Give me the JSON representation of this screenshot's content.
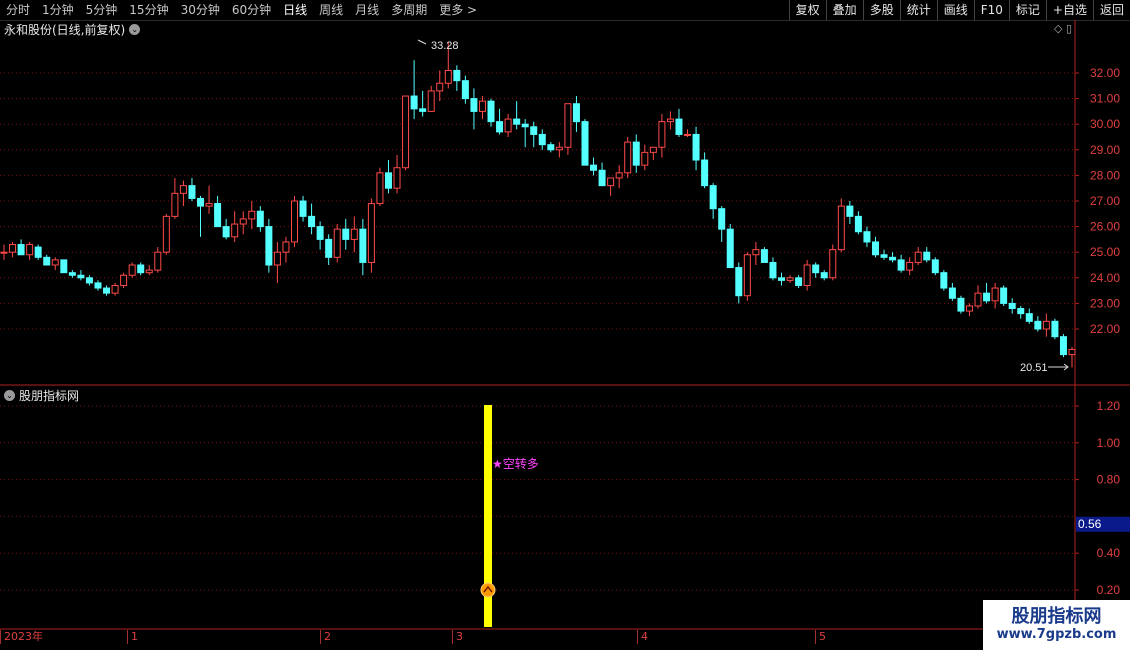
{
  "toolbar": {
    "tabs": [
      "分时",
      "1分钟",
      "5分钟",
      "15分钟",
      "30分钟",
      "60分钟",
      "日线",
      "周线",
      "月线",
      "多周期",
      "更多 >"
    ],
    "active_tab": "日线",
    "tools": [
      "复权",
      "叠加",
      "多股",
      "统计",
      "画线",
      "F10",
      "标记",
      "+自选",
      "返回"
    ]
  },
  "stock": {
    "title": "永和股份(日线,前复权)",
    "high_label": "33.28",
    "low_label": "20.51"
  },
  "indicator": {
    "title": "股朋指标网",
    "signal_label": "★空转多",
    "current_value": "0.56"
  },
  "price_axis": [
    "32.00",
    "31.00",
    "30.00",
    "29.00",
    "28.00",
    "27.00",
    "26.00",
    "25.00",
    "24.00",
    "23.00",
    "22.00"
  ],
  "indicator_axis": [
    "1.20",
    "1.00",
    "0.80",
    "0.40",
    "0.20"
  ],
  "date_axis": [
    "2023年",
    "1",
    "2",
    "3",
    "4",
    "5"
  ],
  "watermark": {
    "line1": "股朋指标网",
    "line2": "www.7gpzb.com"
  },
  "colors": {
    "up": "#ff4a4a",
    "down": "#54ffff",
    "signal": "#ffff00",
    "label": "#ff44ff",
    "grid": "#7a1010"
  },
  "candles": [
    [
      25.0,
      25.3,
      24.7,
      25.0
    ],
    [
      25.0,
      25.4,
      24.8,
      25.3
    ],
    [
      25.3,
      25.5,
      24.9,
      24.9
    ],
    [
      24.9,
      25.4,
      24.7,
      25.3
    ],
    [
      25.2,
      25.3,
      24.7,
      24.8
    ],
    [
      24.8,
      24.9,
      24.5,
      24.5
    ],
    [
      24.5,
      24.8,
      24.3,
      24.7
    ],
    [
      24.7,
      24.7,
      24.2,
      24.2
    ],
    [
      24.2,
      24.3,
      24.0,
      24.1
    ],
    [
      24.1,
      24.3,
      23.9,
      24.0
    ],
    [
      24.0,
      24.1,
      23.7,
      23.8
    ],
    [
      23.8,
      23.9,
      23.5,
      23.6
    ],
    [
      23.6,
      23.7,
      23.3,
      23.4
    ],
    [
      23.4,
      23.8,
      23.3,
      23.7
    ],
    [
      23.7,
      24.2,
      23.6,
      24.1
    ],
    [
      24.1,
      24.6,
      24.0,
      24.5
    ],
    [
      24.5,
      24.6,
      24.1,
      24.2
    ],
    [
      24.2,
      24.5,
      24.1,
      24.3
    ],
    [
      24.3,
      25.2,
      24.2,
      25.0
    ],
    [
      25.0,
      26.5,
      24.9,
      26.4
    ],
    [
      26.4,
      27.9,
      26.3,
      27.3
    ],
    [
      27.3,
      27.8,
      26.8,
      27.6
    ],
    [
      27.6,
      27.9,
      27.0,
      27.1
    ],
    [
      27.1,
      27.2,
      25.6,
      26.8
    ],
    [
      26.8,
      27.6,
      26.5,
      26.9
    ],
    [
      26.9,
      27.2,
      26.0,
      26.0
    ],
    [
      26.0,
      26.3,
      25.5,
      25.6
    ],
    [
      25.6,
      26.6,
      25.4,
      26.1
    ],
    [
      26.1,
      26.6,
      25.7,
      26.3
    ],
    [
      26.3,
      27.0,
      25.9,
      26.6
    ],
    [
      26.6,
      26.8,
      25.8,
      26.0
    ],
    [
      26.0,
      26.3,
      24.2,
      24.5
    ],
    [
      24.5,
      25.4,
      23.8,
      25.0
    ],
    [
      25.0,
      25.6,
      24.6,
      25.4
    ],
    [
      25.4,
      27.2,
      25.2,
      27.0
    ],
    [
      27.0,
      27.2,
      26.2,
      26.4
    ],
    [
      26.4,
      26.9,
      25.7,
      26.0
    ],
    [
      26.0,
      26.2,
      25.1,
      25.5
    ],
    [
      25.5,
      25.7,
      24.5,
      24.8
    ],
    [
      24.8,
      26.1,
      24.6,
      25.9
    ],
    [
      25.9,
      26.3,
      25.1,
      25.5
    ],
    [
      25.5,
      26.4,
      25.0,
      25.9
    ],
    [
      25.9,
      26.3,
      24.1,
      24.6
    ],
    [
      24.6,
      27.1,
      24.2,
      26.9
    ],
    [
      26.9,
      28.3,
      26.8,
      28.1
    ],
    [
      28.1,
      28.6,
      27.3,
      27.5
    ],
    [
      27.5,
      28.8,
      27.3,
      28.3
    ],
    [
      28.3,
      31.1,
      28.2,
      31.1
    ],
    [
      31.1,
      32.5,
      30.2,
      30.6
    ],
    [
      30.6,
      31.3,
      30.3,
      30.5
    ],
    [
      30.5,
      31.5,
      30.6,
      31.3
    ],
    [
      31.3,
      32.1,
      30.9,
      31.6
    ],
    [
      31.6,
      33.2,
      31.4,
      32.1
    ],
    [
      32.1,
      32.3,
      31.3,
      31.7
    ],
    [
      31.7,
      31.9,
      30.8,
      31.0
    ],
    [
      31.0,
      31.4,
      29.8,
      30.5
    ],
    [
      30.5,
      31.1,
      30.2,
      30.9
    ],
    [
      30.9,
      31.0,
      29.9,
      30.1
    ],
    [
      30.1,
      30.6,
      29.6,
      29.7
    ],
    [
      29.7,
      30.4,
      29.5,
      30.2
    ],
    [
      30.2,
      30.9,
      29.8,
      30.0
    ],
    [
      30.0,
      30.2,
      29.1,
      29.9
    ],
    [
      29.9,
      30.1,
      29.1,
      29.6
    ],
    [
      29.6,
      29.8,
      29.0,
      29.2
    ],
    [
      29.2,
      29.3,
      28.9,
      29.0
    ],
    [
      29.0,
      29.3,
      28.7,
      29.1
    ],
    [
      29.1,
      30.8,
      28.8,
      30.8
    ],
    [
      30.8,
      31.1,
      29.7,
      30.1
    ],
    [
      30.1,
      30.2,
      28.4,
      28.4
    ],
    [
      28.4,
      28.7,
      28.0,
      28.2
    ],
    [
      28.2,
      28.5,
      27.6,
      27.6
    ],
    [
      27.6,
      27.9,
      27.2,
      27.9
    ],
    [
      27.9,
      28.4,
      27.5,
      28.1
    ],
    [
      28.1,
      29.5,
      27.9,
      29.3
    ],
    [
      29.3,
      29.6,
      28.1,
      28.4
    ],
    [
      28.4,
      29.2,
      28.2,
      28.9
    ],
    [
      28.9,
      29.1,
      28.6,
      29.1
    ],
    [
      29.1,
      30.4,
      28.7,
      30.1
    ],
    [
      30.1,
      30.5,
      29.8,
      30.2
    ],
    [
      30.2,
      30.6,
      29.5,
      29.6
    ],
    [
      29.6,
      29.8,
      29.5,
      29.6
    ],
    [
      29.6,
      29.9,
      28.2,
      28.6
    ],
    [
      28.6,
      28.9,
      27.5,
      27.6
    ],
    [
      27.6,
      27.7,
      26.3,
      26.7
    ],
    [
      26.7,
      26.8,
      25.4,
      25.9
    ],
    [
      25.9,
      26.1,
      24.9,
      24.4
    ],
    [
      24.4,
      24.6,
      23.0,
      23.3
    ],
    [
      23.3,
      25.0,
      23.1,
      24.9
    ],
    [
      24.9,
      25.4,
      24.5,
      25.1
    ],
    [
      25.1,
      25.2,
      24.6,
      24.6
    ],
    [
      24.6,
      24.8,
      23.9,
      24.0
    ],
    [
      24.0,
      24.2,
      23.7,
      23.9
    ],
    [
      23.9,
      24.1,
      23.8,
      24.0
    ],
    [
      24.0,
      24.1,
      23.6,
      23.7
    ],
    [
      23.7,
      24.7,
      23.5,
      24.5
    ],
    [
      24.5,
      24.6,
      24.0,
      24.2
    ],
    [
      24.2,
      24.3,
      23.9,
      24.0
    ],
    [
      24.0,
      25.3,
      23.9,
      25.1
    ],
    [
      25.1,
      27.1,
      25.0,
      26.8
    ],
    [
      26.8,
      27.0,
      26.1,
      26.4
    ],
    [
      26.4,
      26.6,
      25.7,
      25.8
    ],
    [
      25.8,
      26.0,
      25.2,
      25.4
    ],
    [
      25.4,
      25.6,
      24.8,
      24.9
    ],
    [
      24.9,
      25.1,
      24.7,
      24.8
    ],
    [
      24.8,
      25.0,
      24.6,
      24.7
    ],
    [
      24.7,
      24.9,
      24.2,
      24.3
    ],
    [
      24.3,
      24.8,
      24.1,
      24.6
    ],
    [
      24.6,
      25.2,
      24.5,
      25.0
    ],
    [
      25.0,
      25.2,
      24.6,
      24.7
    ],
    [
      24.7,
      24.8,
      24.1,
      24.2
    ],
    [
      24.2,
      24.3,
      23.5,
      23.6
    ],
    [
      23.6,
      23.8,
      23.1,
      23.2
    ],
    [
      23.2,
      23.3,
      22.6,
      22.7
    ],
    [
      22.7,
      23.0,
      22.5,
      22.9
    ],
    [
      22.9,
      23.7,
      22.8,
      23.4
    ],
    [
      23.4,
      23.8,
      23.0,
      23.1
    ],
    [
      23.1,
      23.8,
      22.8,
      23.6
    ],
    [
      23.6,
      23.7,
      22.9,
      23.0
    ],
    [
      23.0,
      23.2,
      22.6,
      22.8
    ],
    [
      22.8,
      22.9,
      22.4,
      22.6
    ],
    [
      22.6,
      22.8,
      22.2,
      22.3
    ],
    [
      22.3,
      22.5,
      21.9,
      22.0
    ],
    [
      22.0,
      22.6,
      21.7,
      22.3
    ],
    [
      22.3,
      22.4,
      21.6,
      21.7
    ],
    [
      21.7,
      21.8,
      20.9,
      21.0
    ],
    [
      21.0,
      21.3,
      20.5,
      21.2
    ]
  ]
}
